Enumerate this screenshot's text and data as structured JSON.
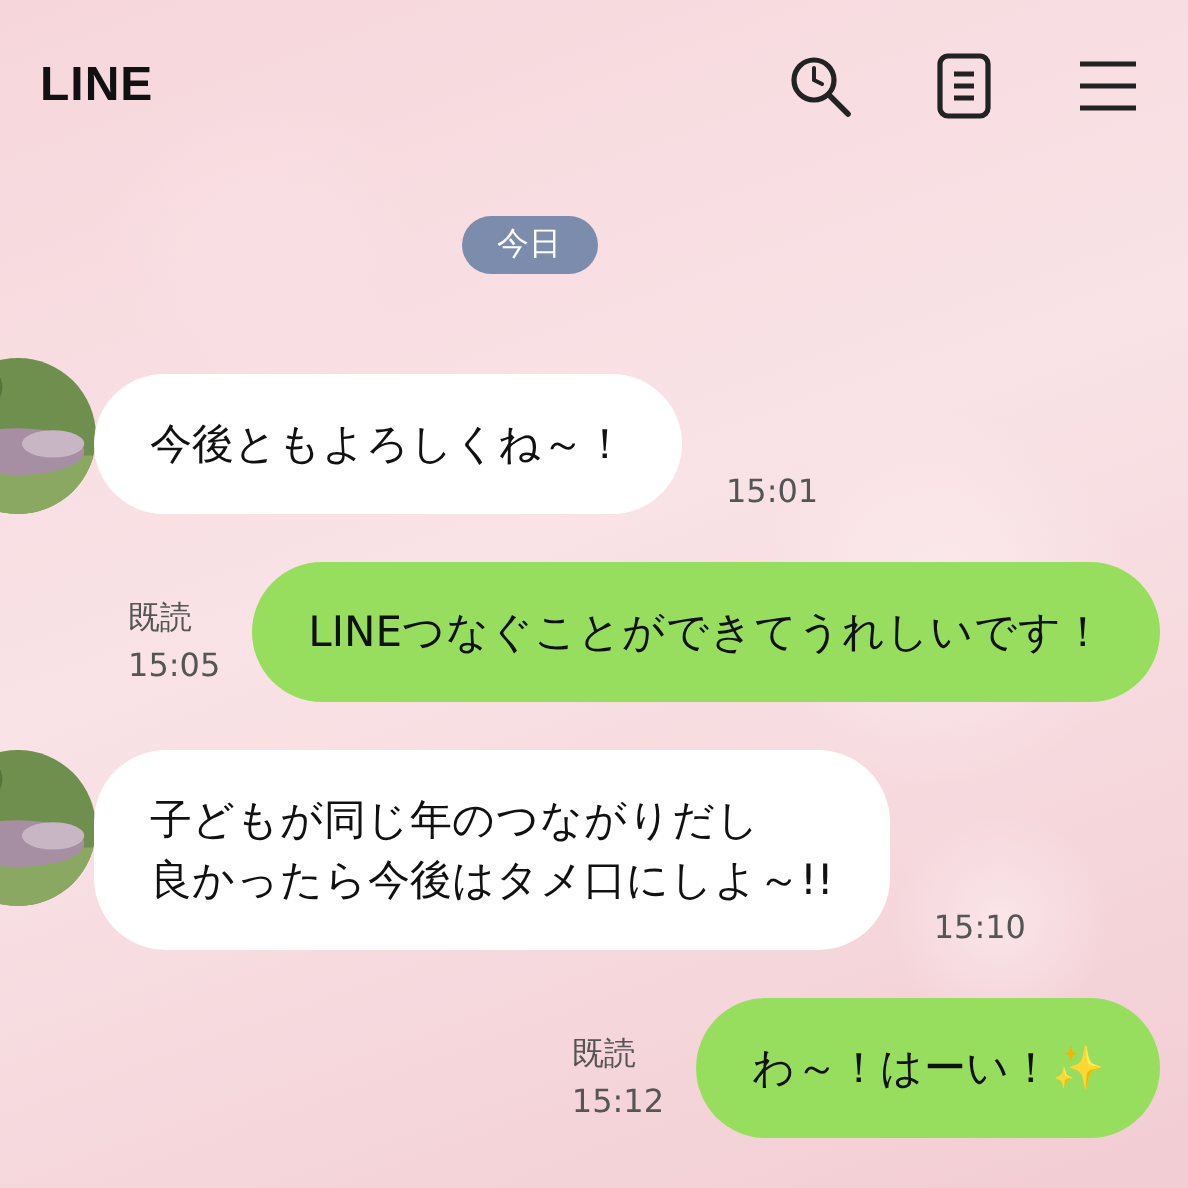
{
  "header": {
    "title": "LINE"
  },
  "date_label": "今日",
  "messages": [
    {
      "kind": "received",
      "lines": [
        "今後ともよろしくね～！"
      ],
      "time": "15:01"
    },
    {
      "kind": "sent",
      "lines": [
        "LINEつなぐことができてうれしいです！"
      ],
      "read": "既読",
      "time": "15:05"
    },
    {
      "kind": "received",
      "lines": [
        "子どもが同じ年のつながりだし",
        "良かったら今後はタメ口にしよ～!!"
      ],
      "time": "15:10"
    },
    {
      "kind": "sent",
      "lines": [
        "わ～！はーい！✨"
      ],
      "read": "既読",
      "time": "15:12"
    }
  ]
}
